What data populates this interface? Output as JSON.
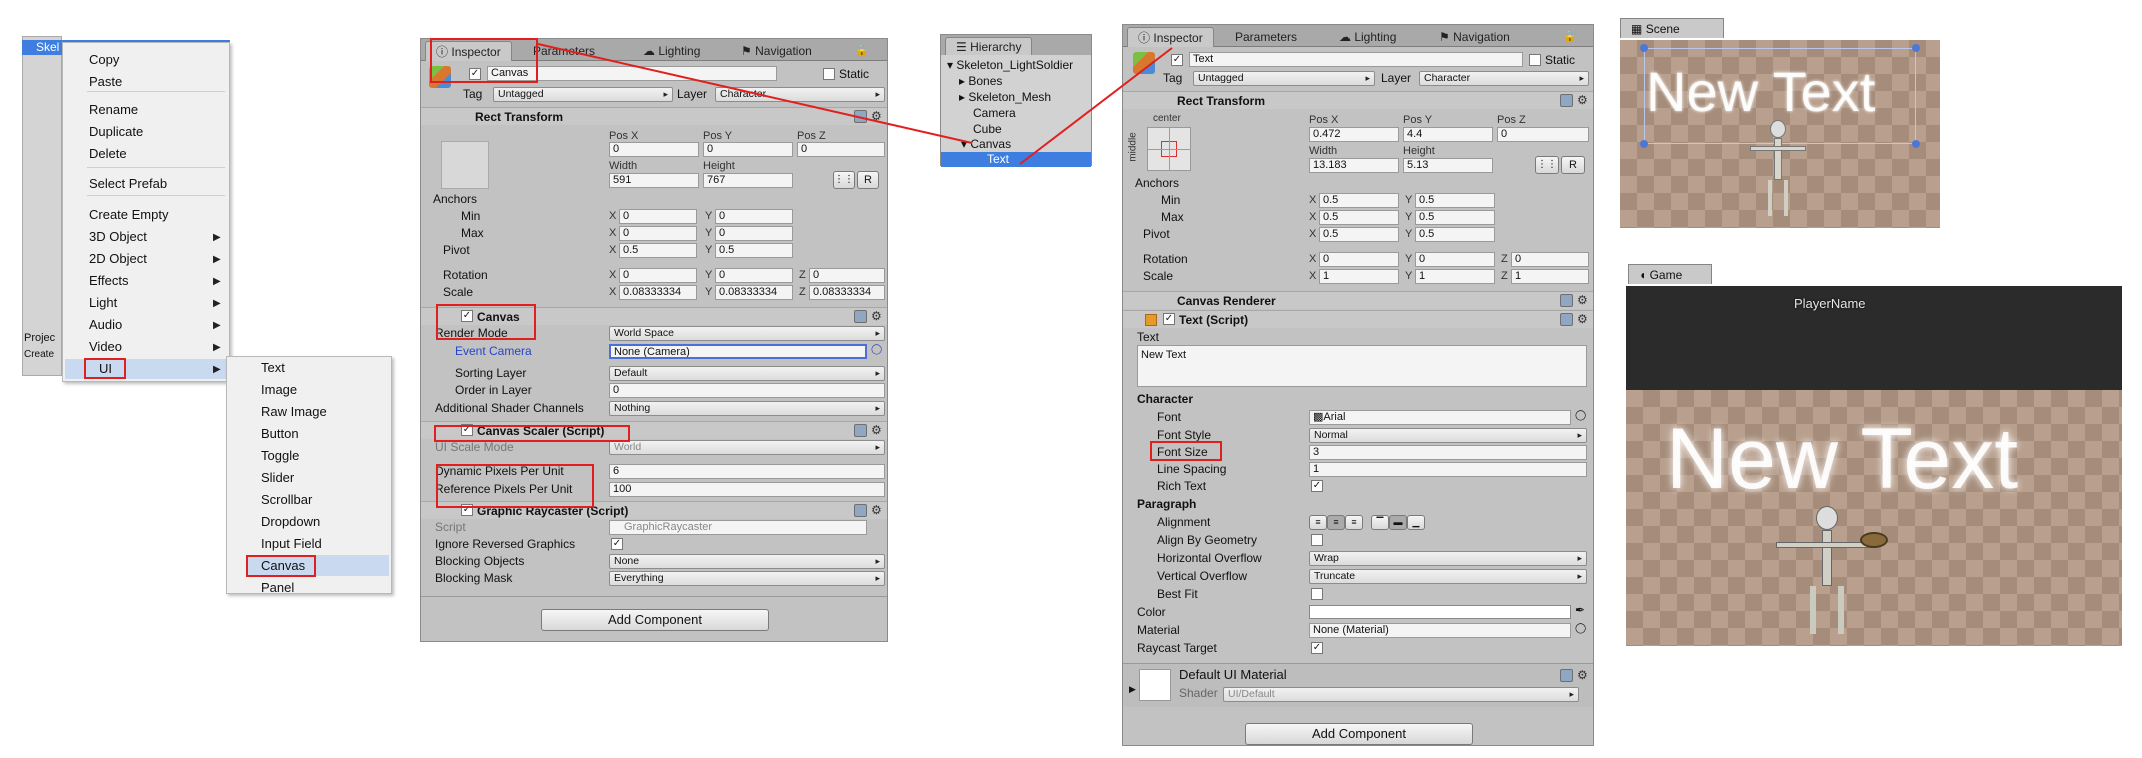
{
  "context_menu": {
    "header_item": "Skel",
    "create_label": "Create",
    "project_tab": "Projec",
    "items": [
      "Copy",
      "Paste",
      "Rename",
      "Duplicate",
      "Delete",
      "Select Prefab",
      "Create Empty",
      "3D Object",
      "2D Object",
      "Effects",
      "Light",
      "Audio",
      "Video",
      "UI"
    ]
  },
  "ui_submenu": {
    "items": [
      "Text",
      "Image",
      "Raw Image",
      "Button",
      "Toggle",
      "Slider",
      "Scrollbar",
      "Dropdown",
      "Input Field",
      "Canvas",
      "Panel"
    ]
  },
  "inspector1": {
    "tabs": [
      "Inspector",
      "Parameters",
      "Lighting",
      "Navigation"
    ],
    "object_name": "Canvas",
    "static_label": "Static",
    "tag_label": "Tag",
    "tag_value": "Untagged",
    "layer_label": "Layer",
    "layer_value": "Character",
    "rect_title": "Rect Transform",
    "posx_label": "Pos X",
    "posy_label": "Pos Y",
    "posz_label": "Pos Z",
    "posx": "0",
    "posy": "0",
    "posz": "0",
    "width_label": "Width",
    "height_label": "Height",
    "width": "591",
    "height": "767",
    "r_btn": "R",
    "anchors_label": "Anchors",
    "min_label": "Min",
    "max_label": "Max",
    "pivot_label": "Pivot",
    "rotation_label": "Rotation",
    "scale_label": "Scale",
    "x": "X",
    "y": "Y",
    "z": "Z",
    "anchor_min_x": "0",
    "anchor_min_y": "0",
    "anchor_max_x": "0",
    "anchor_max_y": "0",
    "pivot_x": "0.5",
    "pivot_y": "0.5",
    "rot_x": "0",
    "rot_y": "0",
    "rot_z": "0",
    "scale_x": "0.08333334",
    "scale_y": "0.08333334",
    "scale_z": "0.08333334",
    "canvas_title": "Canvas",
    "render_mode_label": "Render Mode",
    "render_mode": "World Space",
    "event_camera_label": "Event Camera",
    "event_camera": "None (Camera)",
    "sorting_layer_label": "Sorting Layer",
    "sorting_layer": "Default",
    "order_label": "Order in Layer",
    "order": "0",
    "shader_channels_label": "Additional Shader Channels",
    "shader_channels": "Nothing",
    "scaler_title": "Canvas Scaler (Script)",
    "scale_mode_label": "UI Scale Mode",
    "scale_mode": "World",
    "dpu_label": "Dynamic Pixels Per Unit",
    "dpu": "6",
    "rpu_label": "Reference Pixels Per Unit",
    "rpu": "100",
    "raycaster_title": "Graphic Raycaster (Script)",
    "script_label": "Script",
    "script_value": "GraphicRaycaster",
    "ignore_label": "Ignore Reversed Graphics",
    "blocking_objects_label": "Blocking Objects",
    "blocking_objects": "None",
    "blocking_mask_label": "Blocking Mask",
    "blocking_mask": "Everything",
    "add_component": "Add Component"
  },
  "hierarchy": {
    "title": "Hierarchy",
    "items": [
      "Skeleton_LightSoldier",
      "Bones",
      "Skeleton_Mesh",
      "Camera",
      "Cube",
      "Canvas",
      "Text"
    ]
  },
  "inspector2": {
    "tabs": [
      "Inspector",
      "Parameters",
      "Lighting",
      "Navigation"
    ],
    "object_name": "Text",
    "static_label": "Static",
    "tag_label": "Tag",
    "tag_value": "Untagged",
    "layer_label": "Layer",
    "layer_value": "Character",
    "rect_title": "Rect Transform",
    "anchor_preset_top": "center",
    "anchor_preset_side": "middle",
    "posx_label": "Pos X",
    "posy_label": "Pos Y",
    "posz_label": "Pos Z",
    "posx": "0.472",
    "posy": "4.4",
    "posz": "0",
    "width_label": "Width",
    "height_label": "Height",
    "width": "13.183",
    "height": "5.13",
    "r_btn": "R",
    "anchors_label": "Anchors",
    "min_label": "Min",
    "max_label": "Max",
    "pivot_label": "Pivot",
    "rotation_label": "Rotation",
    "scale_label": "Scale",
    "x": "X",
    "y": "Y",
    "z": "Z",
    "anchor_min_x": "0.5",
    "anchor_min_y": "0.5",
    "anchor_max_x": "0.5",
    "anchor_max_y": "0.5",
    "pivot_x": "0.5",
    "pivot_y": "0.5",
    "rot_x": "0",
    "rot_y": "0",
    "rot_z": "0",
    "scale_x": "1",
    "scale_y": "1",
    "scale_z": "1",
    "renderer_title": "Canvas Renderer",
    "text_title": "Text (Script)",
    "text_label": "Text",
    "text_value": "New Text",
    "character_label": "Character",
    "font_label": "Font",
    "font_value": "Arial",
    "font_style_label": "Font Style",
    "font_style": "Normal",
    "font_size_label": "Font Size",
    "font_size": "3",
    "line_spacing_label": "Line Spacing",
    "line_spacing": "1",
    "rich_text_label": "Rich Text",
    "paragraph_label": "Paragraph",
    "alignment_label": "Alignment",
    "align_geometry_label": "Align By Geometry",
    "h_overflow_label": "Horizontal Overflow",
    "h_overflow": "Wrap",
    "v_overflow_label": "Vertical Overflow",
    "v_overflow": "Truncate",
    "best_fit_label": "Best Fit",
    "color_label": "Color",
    "material_label": "Material",
    "material_value": "None (Material)",
    "raycast_label": "Raycast Target",
    "default_material": "Default UI Material",
    "shader_label": "Shader",
    "shader_value": "UI/Default",
    "add_component": "Add Component"
  },
  "scene": {
    "tab": "Scene",
    "overlay_text": "New Text"
  },
  "game": {
    "tab": "Game",
    "player_name": "PlayerName",
    "overlay_text": "New Text"
  },
  "colors": {
    "highlight_red": "#e0201f",
    "selection_blue": "#3d7ee0",
    "panel_gray": "#c2c2c2"
  }
}
